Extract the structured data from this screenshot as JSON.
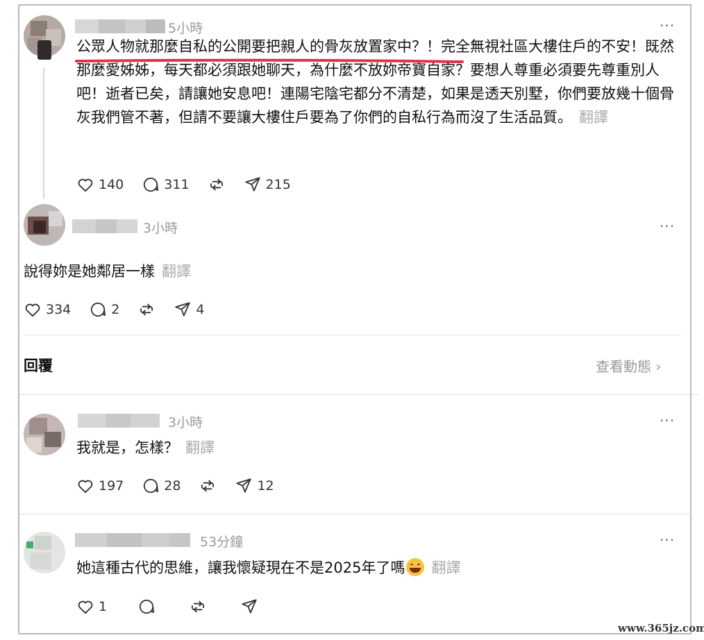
{
  "post": {
    "time": "5小時",
    "more": "···",
    "text": "公眾人物就那麼自私的公開要把親人的骨灰放置家中？！完全無視社區大樓住戶的不安！既然那麼愛姊姊，每天都必須跟她聊天，為什麼不放妳帝寶自家？要想人尊重必須要先尊重別人吧！逝者已矣，請讓她安息吧！連陽宅陰宅都分不清楚，如果是透天別墅，你們要放幾十個骨灰我們管不著，但請不要讓大樓住戶要為了你們的自私行為而沒了生活品質。",
    "translate": "翻譯",
    "likes": "140",
    "comments": "311",
    "shares": "215",
    "underline_color": "#e0314b"
  },
  "reply1": {
    "time": "3小時",
    "more": "···",
    "text": "說得妳是她鄰居一樣",
    "translate": "翻譯",
    "likes": "334",
    "comments": "2",
    "shares": "4"
  },
  "section": {
    "reply_label": "回覆",
    "activity_label": "查看動態 ›"
  },
  "comment1": {
    "time": "3小時",
    "more": "···",
    "text": "我就是，怎樣？",
    "translate": "翻譯",
    "likes": "197",
    "comments": "28",
    "shares": "12"
  },
  "comment2": {
    "time": "53分鐘",
    "more": "···",
    "text": "她這種古代的思維，讓我懷疑現在不是2025年了嗎",
    "emoji": "grinning-sweat-emoji",
    "translate": "翻譯",
    "likes": "1"
  },
  "watermark": "www.365jz.com",
  "icons": [
    "heart-icon",
    "comment-icon",
    "repost-icon",
    "share-icon",
    "more-icon"
  ]
}
